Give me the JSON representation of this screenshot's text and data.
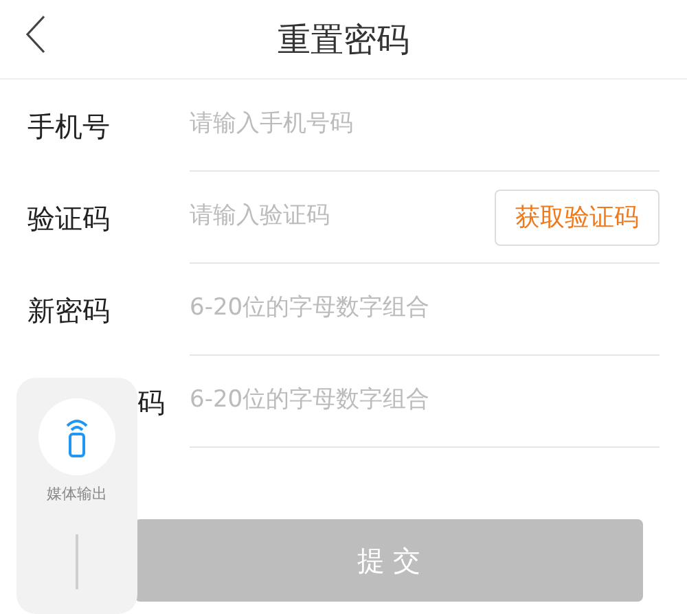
{
  "header": {
    "title": "重置密码"
  },
  "fields": [
    {
      "label": "手机号",
      "placeholder": "请输入手机号码",
      "partially_hidden": false
    },
    {
      "label": "验证码",
      "placeholder": "请输入验证码",
      "partially_hidden": false,
      "button": "获取验证码"
    },
    {
      "label": "新密码",
      "placeholder": "6-20位的字母数字组合",
      "partially_hidden": false
    },
    {
      "label": "码",
      "placeholder": "6-20位的字母数字组合",
      "partially_hidden": true
    }
  ],
  "submit": "提 交",
  "media_panel": {
    "label": "媒体输出"
  }
}
